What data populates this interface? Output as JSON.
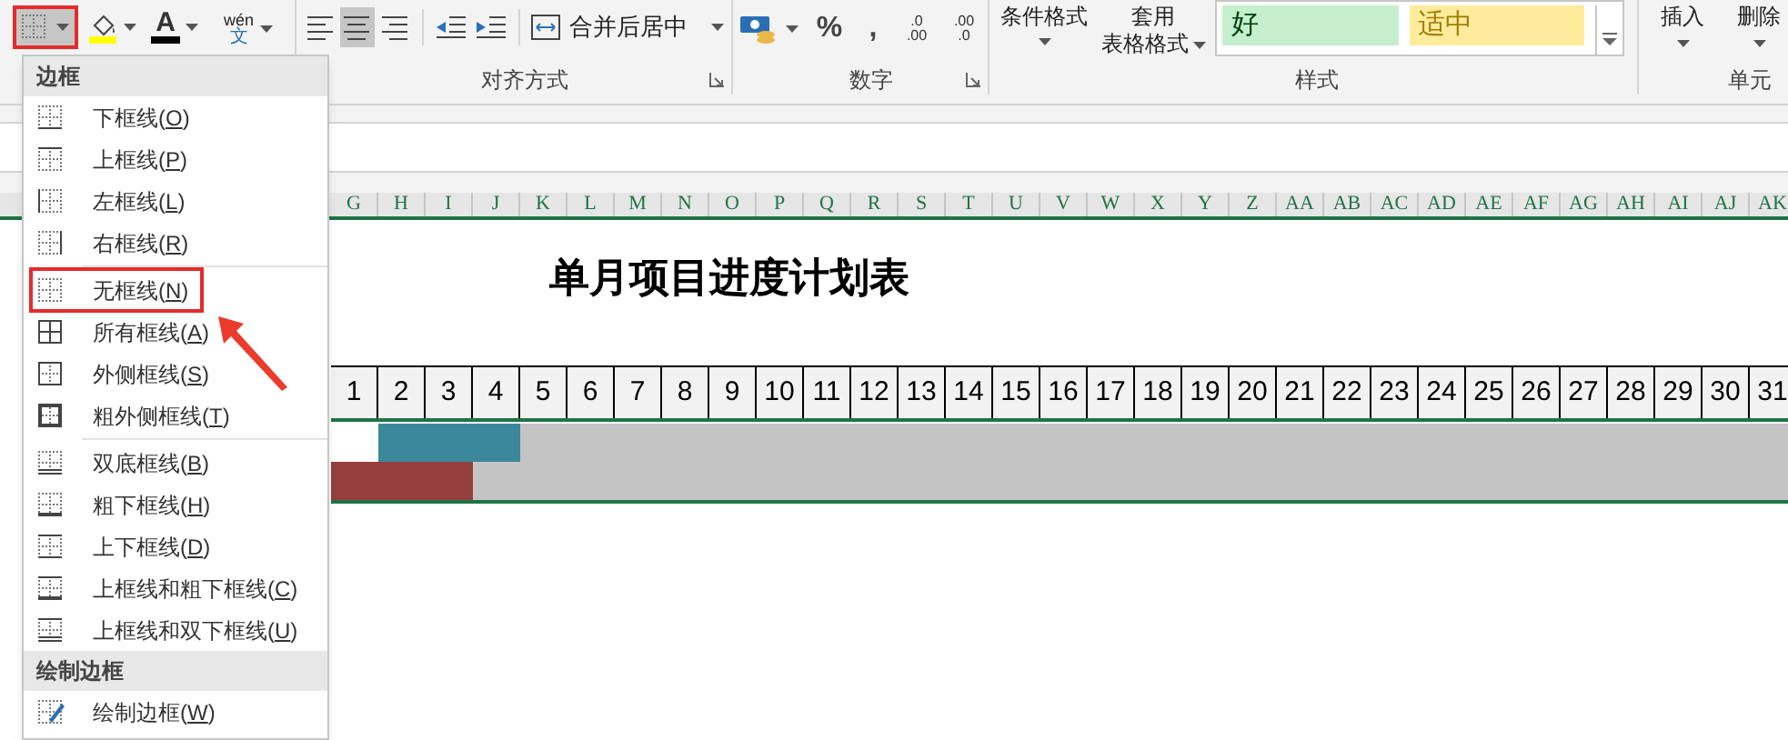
{
  "ribbon": {
    "phonetic": {
      "top": "wén",
      "bottom": "文"
    },
    "font_color_letter": "A",
    "merge_button": "合并后居中",
    "align_buttons": [
      {
        "kind": "left",
        "selected": false
      },
      {
        "kind": "center",
        "selected": true
      },
      {
        "kind": "right",
        "selected": false
      }
    ],
    "percent": "%",
    "comma": ",",
    "decimal_buttons": [
      {
        "top": ".0",
        "bottom": ".00"
      },
      {
        "top": ".00",
        "bottom": ".0"
      }
    ],
    "conditional_format": "条件格式",
    "table_format_top": "套用",
    "table_format_bottom": "表格格式",
    "styles": [
      {
        "label": "好",
        "color": "#c6efce"
      },
      {
        "label": "适中",
        "color": "#ffeb9c"
      }
    ],
    "insert": "插入",
    "delete": "删除",
    "groups": [
      "对齐方式",
      "数字",
      "样式",
      "单元"
    ]
  },
  "sheet": {
    "columns": [
      "G",
      "H",
      "I",
      "J",
      "K",
      "L",
      "M",
      "N",
      "O",
      "P",
      "Q",
      "R",
      "S",
      "T",
      "U",
      "V",
      "W",
      "X",
      "Y",
      "Z",
      "AA",
      "AB",
      "AC",
      "AD",
      "AE",
      "AF",
      "AG",
      "AH",
      "AI",
      "AJ",
      "AK"
    ],
    "title": "单月项目进度计划表",
    "days": [
      "1",
      "2",
      "3",
      "4",
      "5",
      "6",
      "7",
      "8",
      "9",
      "10",
      "11",
      "12",
      "13",
      "14",
      "15",
      "16",
      "17",
      "18",
      "19",
      "20",
      "21",
      "22",
      "23",
      "24",
      "25",
      "26",
      "27",
      "28",
      "29",
      "30",
      "31"
    ],
    "bar_rows": [
      {
        "segments": [
          {
            "kind": "gap",
            "level": 0.0323
          },
          {
            "kind": "bar",
            "color": "#3a8899",
            "level": 0.0968
          }
        ]
      },
      {
        "segments": [
          {
            "kind": "bar",
            "color": "#953f3f",
            "level": 0.0968
          }
        ]
      }
    ]
  },
  "border_menu": {
    "sections": [
      {
        "title": "边框",
        "groups": [
          {
            "items": [
              {
                "kind": "bottom",
                "label": "下框线(",
                "key": "O",
                "selected": false
              },
              {
                "kind": "top",
                "label": "上框线(",
                "key": "P",
                "selected": false
              },
              {
                "kind": "left",
                "label": "左框线(",
                "key": "L",
                "selected": false
              },
              {
                "kind": "right",
                "label": "右框线(",
                "key": "R",
                "selected": false
              }
            ]
          },
          {
            "items": [
              {
                "kind": "none",
                "label": "无框线(",
                "key": "N",
                "selected": true
              },
              {
                "kind": "all",
                "label": "所有框线(",
                "key": "A",
                "selected": false
              },
              {
                "kind": "outside",
                "label": "外侧框线(",
                "key": "S",
                "selected": false
              },
              {
                "kind": "thick_outside",
                "label": "粗外侧框线(",
                "key": "T",
                "selected": false
              }
            ]
          },
          {
            "items": [
              {
                "kind": "double_bottom",
                "label": "双底框线(",
                "key": "B",
                "selected": false
              },
              {
                "kind": "thick_bottom",
                "label": "粗下框线(",
                "key": "H",
                "selected": false
              },
              {
                "kind": "top_bottom",
                "label": "上下框线(",
                "key": "D",
                "selected": false
              },
              {
                "kind": "top_thick_bottom",
                "label": "上框线和粗下框线(",
                "key": "C",
                "selected": false
              },
              {
                "kind": "top_double_bottom",
                "label": "上框线和双下框线(",
                "key": "U",
                "selected": false
              }
            ]
          }
        ]
      },
      {
        "title": "绘制边框",
        "groups": [
          {
            "items": [
              {
                "kind": "draw",
                "label": "绘制边框(",
                "key": "W",
                "selected": false
              }
            ]
          }
        ]
      }
    ],
    "close_paren": ")"
  }
}
